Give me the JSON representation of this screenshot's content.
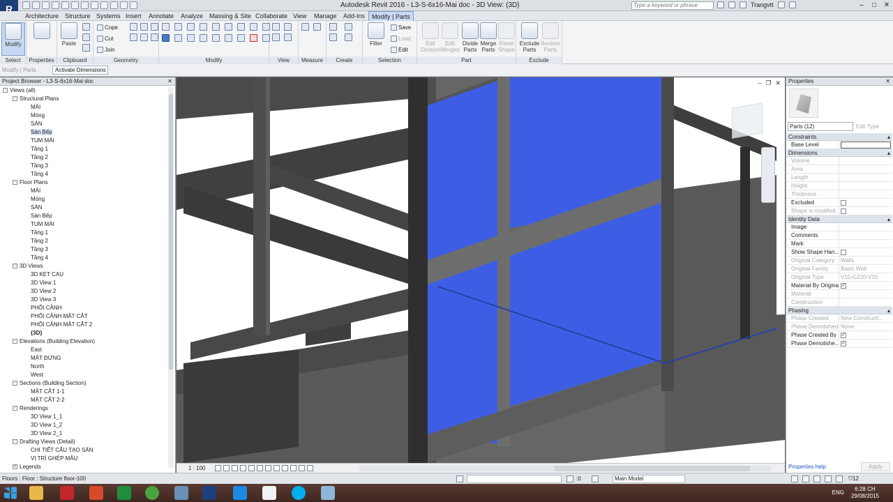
{
  "app": {
    "logo": "R",
    "title": "Autodesk Revit 2016 -    L3-S-6x16-Mai doc - 3D View: {3D}",
    "search_placeholder": "Type a keyword or phrase",
    "user": "Trangvtt"
  },
  "tabs": [
    "Architecture",
    "Structure",
    "Systems",
    "Insert",
    "Annotate",
    "Analyze",
    "Massing & Site",
    "Collaborate",
    "View",
    "Manage",
    "Add-Ins",
    "Modify | Parts"
  ],
  "ribbon": {
    "select": {
      "modify_label": "Modify",
      "panel": "Select"
    },
    "properties": {
      "panel": "Properties"
    },
    "clipboard": {
      "paste": "Paste",
      "panel": "Clipboard"
    },
    "geometry": {
      "cope": "Cope",
      "cut": "Cut",
      "join": "Join",
      "panel": "Geometry"
    },
    "modify": {
      "panel": "Modify"
    },
    "view": {
      "panel": "View"
    },
    "measure": {
      "panel": "Measure"
    },
    "create": {
      "panel": "Create"
    },
    "selection": {
      "filter": "Filter",
      "save": "Save",
      "load": "Load",
      "edit": "Edit",
      "panel": "Selection"
    },
    "part": {
      "edit_division": "Edit Division",
      "edit_merged": "Edit Merged",
      "divide_parts": "Divide Parts",
      "merge_parts": "Merge Parts",
      "reset_shape": "Reset Shape",
      "panel": "Part"
    },
    "exclude": {
      "exclude_parts": "Exclude Parts",
      "restore_parts": "Restore Parts",
      "panel": "Exclude"
    }
  },
  "subbar": {
    "context": "Modify | Parts",
    "activate": "Activate Dimensions"
  },
  "project_browser": {
    "title": "Project Browser - L3-S-6x16-Mai doc",
    "rows": [
      {
        "label": "Views (all)",
        "level": 0,
        "toggle": "-"
      },
      {
        "label": "Structural Plans",
        "level": 1,
        "toggle": "-"
      },
      {
        "label": "MÁI",
        "level": 2
      },
      {
        "label": "Móng",
        "level": 2
      },
      {
        "label": "SÀN",
        "level": 2
      },
      {
        "label": "Sàn Bếp",
        "level": 2,
        "selected": true
      },
      {
        "label": "TUM MÁI",
        "level": 2
      },
      {
        "label": "Tầng 1",
        "level": 2
      },
      {
        "label": "Tầng 2",
        "level": 2
      },
      {
        "label": "Tầng 3",
        "level": 2
      },
      {
        "label": "Tầng 4",
        "level": 2
      },
      {
        "label": "Floor Plans",
        "level": 1,
        "toggle": "-"
      },
      {
        "label": "MÁI",
        "level": 2
      },
      {
        "label": "Móng",
        "level": 2
      },
      {
        "label": "SÀN",
        "level": 2
      },
      {
        "label": "Sàn Bếp",
        "level": 2
      },
      {
        "label": "TUM MÁI",
        "level": 2
      },
      {
        "label": "Tầng 1",
        "level": 2
      },
      {
        "label": "Tầng 2",
        "level": 2
      },
      {
        "label": "Tầng 3",
        "level": 2
      },
      {
        "label": "Tầng 4",
        "level": 2
      },
      {
        "label": "3D Views",
        "level": 1,
        "toggle": "-"
      },
      {
        "label": "3D KET CAU",
        "level": 2
      },
      {
        "label": "3D View 1",
        "level": 2
      },
      {
        "label": "3D View 2",
        "level": 2
      },
      {
        "label": "3D View 3",
        "level": 2
      },
      {
        "label": "PHỐI CẢNH",
        "level": 2
      },
      {
        "label": "PHỐI CẢNH MẶT CẮT",
        "level": 2
      },
      {
        "label": "PHỐI CẢNH MẶT CẮT 2",
        "level": 2
      },
      {
        "label": "{3D}",
        "level": 2,
        "bold": true
      },
      {
        "label": "Elevations (Building Elevation)",
        "level": 1,
        "toggle": "-"
      },
      {
        "label": "East",
        "level": 2
      },
      {
        "label": "MẶT ĐỨNG",
        "level": 2
      },
      {
        "label": "North",
        "level": 2
      },
      {
        "label": "West",
        "level": 2
      },
      {
        "label": "Sections (Building Section)",
        "level": 1,
        "toggle": "-"
      },
      {
        "label": "MẶT CẮT 1-1",
        "level": 2
      },
      {
        "label": "MẶT CẮT 2-2",
        "level": 2
      },
      {
        "label": "Renderings",
        "level": 1,
        "toggle": "-"
      },
      {
        "label": "3D View 1_1",
        "level": 2
      },
      {
        "label": "3D View 1_2",
        "level": 2
      },
      {
        "label": "3D View 2_1",
        "level": 2
      },
      {
        "label": "Drafting Views (Detail)",
        "level": 1,
        "toggle": "-"
      },
      {
        "label": "CHI TIẾT CẤU TẠO SÀN",
        "level": 2
      },
      {
        "label": "VỊ TRÍ GHÉP MẪU",
        "level": 2
      },
      {
        "label": "Legends",
        "level": 1,
        "toggle": "+"
      }
    ]
  },
  "viewport": {
    "scale": "1 : 100"
  },
  "properties": {
    "title": "Properties",
    "type_selector": "Parts (12)",
    "edit_type": "Edit Type",
    "sections": [
      {
        "name": "Constraints",
        "rows": [
          {
            "k": "Base Level",
            "v": "",
            "input": true
          }
        ]
      },
      {
        "name": "Dimensions",
        "rows": [
          {
            "k": "Volume",
            "v": "",
            "dis": true
          },
          {
            "k": "Area",
            "v": "",
            "dis": true
          },
          {
            "k": "Length",
            "v": "",
            "dis": true
          },
          {
            "k": "Height",
            "v": "",
            "dis": true
          },
          {
            "k": "Thickness",
            "v": "",
            "dis": true
          },
          {
            "k": "Excluded",
            "v": "",
            "cb": ""
          },
          {
            "k": "Shape is modified",
            "v": "",
            "cb": "",
            "dis": true
          }
        ]
      },
      {
        "name": "Identity Data",
        "rows": [
          {
            "k": "Image",
            "v": ""
          },
          {
            "k": "Comments",
            "v": ""
          },
          {
            "k": "Mark",
            "v": ""
          },
          {
            "k": "Show Shape Han...",
            "v": "",
            "cb": ""
          },
          {
            "k": "Original Category",
            "v": "Walls",
            "dis": true
          },
          {
            "k": "Original Family",
            "v": "Basic Wall",
            "dis": true
          },
          {
            "k": "Original Type",
            "v": "V15-G220-V15",
            "dis": true
          },
          {
            "k": "Material By Original",
            "v": "",
            "cb": "✓"
          },
          {
            "k": "Material",
            "v": "",
            "dis": true
          },
          {
            "k": "Construction",
            "v": "",
            "dis": true
          }
        ]
      },
      {
        "name": "Phasing",
        "rows": [
          {
            "k": "Phase Created",
            "v": "New Constructi...",
            "dis": true
          },
          {
            "k": "Phase Demolished",
            "v": "None",
            "dis": true
          },
          {
            "k": "Phase Created By ...",
            "v": "",
            "cb": "✓"
          },
          {
            "k": "Phase Demolishe...",
            "v": "",
            "cb": "✓"
          }
        ]
      }
    ],
    "help": "Properties help",
    "apply": "Apply"
  },
  "status": {
    "text": "Floors : Floor : Structure floor-100",
    "zero": ":0",
    "model": "Main Model",
    "filter_count": "12"
  },
  "taskbar": {
    "lang": "ENG",
    "time": "6:28 CH",
    "date": "29/08/2015"
  },
  "colors": {
    "selection_blue": "#3b5fe0",
    "accent": "#c9daf2"
  }
}
